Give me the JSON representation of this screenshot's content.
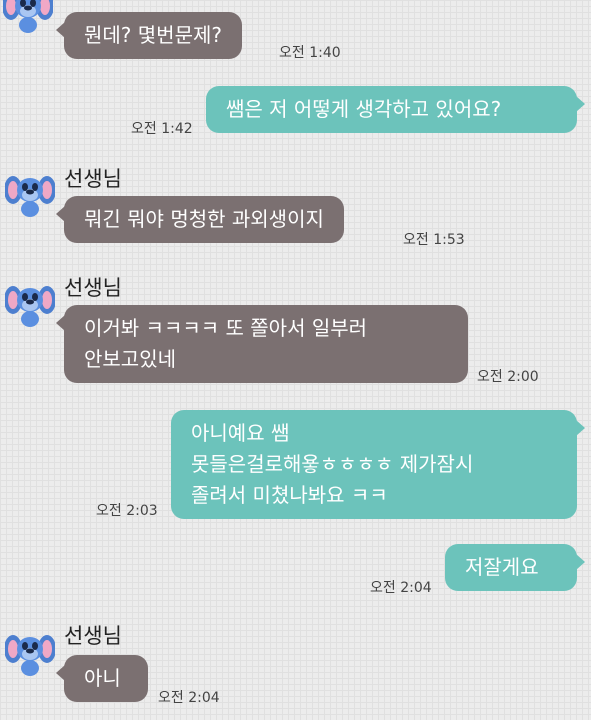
{
  "chat": {
    "colors": {
      "incoming_bubble": "#7b7071",
      "outgoing_bubble": "#6cc3bb",
      "background": "#ececec"
    },
    "avatar_icon": "stitch-avatar-icon",
    "messages": [
      {
        "sender": "",
        "direction": "in",
        "lines": [
          "뭔데? 몇번문제?"
        ],
        "time": "오전 1:40"
      },
      {
        "direction": "out",
        "lines": [
          "쌤은 저 어떻게 생각하고 있어요?"
        ],
        "time": "오전 1:42"
      },
      {
        "sender": "선생님",
        "direction": "in",
        "lines": [
          "뭐긴 뭐야 멍청한 과외생이지"
        ],
        "time": "오전 1:53"
      },
      {
        "sender": "선생님",
        "direction": "in",
        "lines": [
          "이거봐 ㅋㅋㅋㅋ 또 쫄아서 일부러",
          "안보고있네"
        ],
        "time": "오전 2:00"
      },
      {
        "direction": "out",
        "lines": [
          "아니예요 쌤",
          "못들은걸로해욯ㅎㅎㅎㅎ 제가잠시",
          "졸려서 미쳤나봐요 ㅋㅋ"
        ],
        "time": "오전 2:03"
      },
      {
        "direction": "out",
        "lines": [
          "저잘게요"
        ],
        "time": "오전 2:04"
      },
      {
        "sender": "선생님",
        "direction": "in",
        "lines": [
          "아니"
        ],
        "time": "오전 2:04"
      }
    ]
  }
}
